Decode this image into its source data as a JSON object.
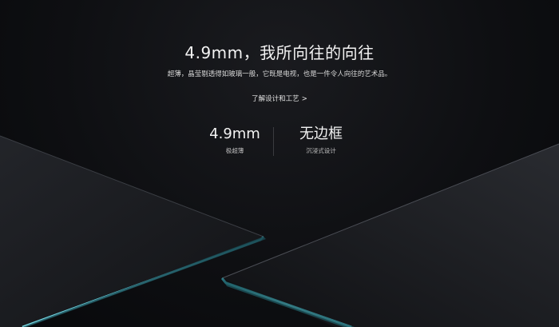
{
  "headline": "4.9mm，我所向往的向往",
  "subtitle": "超薄，晶莹剔透得如玻璃一般，它既是电视，也是一件令人向往的艺术品。",
  "learn_more": {
    "label": "了解设计和工艺",
    "chevron": ">"
  },
  "stats": [
    {
      "value": "4.9mm",
      "label": "极超薄"
    },
    {
      "value": "无边框",
      "label": "沉浸式设计"
    }
  ],
  "colors": {
    "background": "#0b0b0d",
    "edge_glow": "#5fd6e6",
    "panel": "#1b1d22"
  }
}
